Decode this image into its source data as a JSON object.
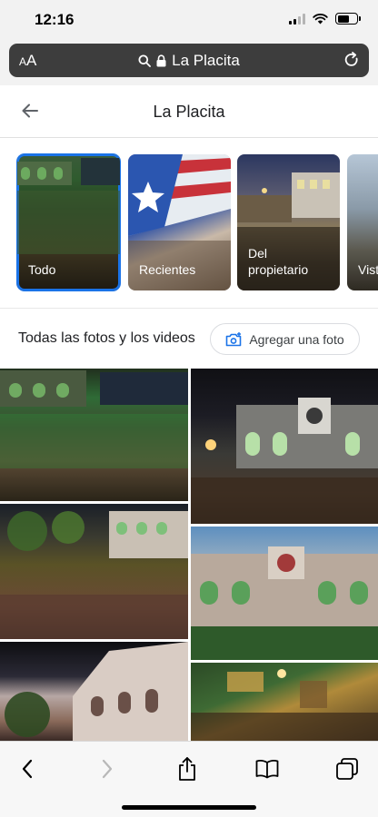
{
  "status": {
    "time": "12:16",
    "battery_level": 0.6,
    "signal_bars_active": 2,
    "signal_bars_total": 4
  },
  "browser": {
    "text_size_label": "AA",
    "address": "La Placita",
    "toolbar": {
      "back": "chevron-left-icon",
      "forward": "chevron-right-icon",
      "share": "share-icon",
      "bookmarks": "book-icon",
      "tabs": "tabs-icon"
    }
  },
  "page": {
    "title": "La Placita"
  },
  "categories": [
    {
      "label": "Todo",
      "selected": true
    },
    {
      "label": "Recientes",
      "selected": false
    },
    {
      "label": "Del\npropietario",
      "selected": false
    },
    {
      "label": "Vist",
      "selected": false
    }
  ],
  "section": {
    "title": "Todas las fotos y los videos",
    "add_photo_label": "Agregar una foto"
  },
  "colors": {
    "accent": "#1a73e8",
    "address_bar": "#3d3d3d",
    "chrome_bg": "#f2f2f2"
  }
}
